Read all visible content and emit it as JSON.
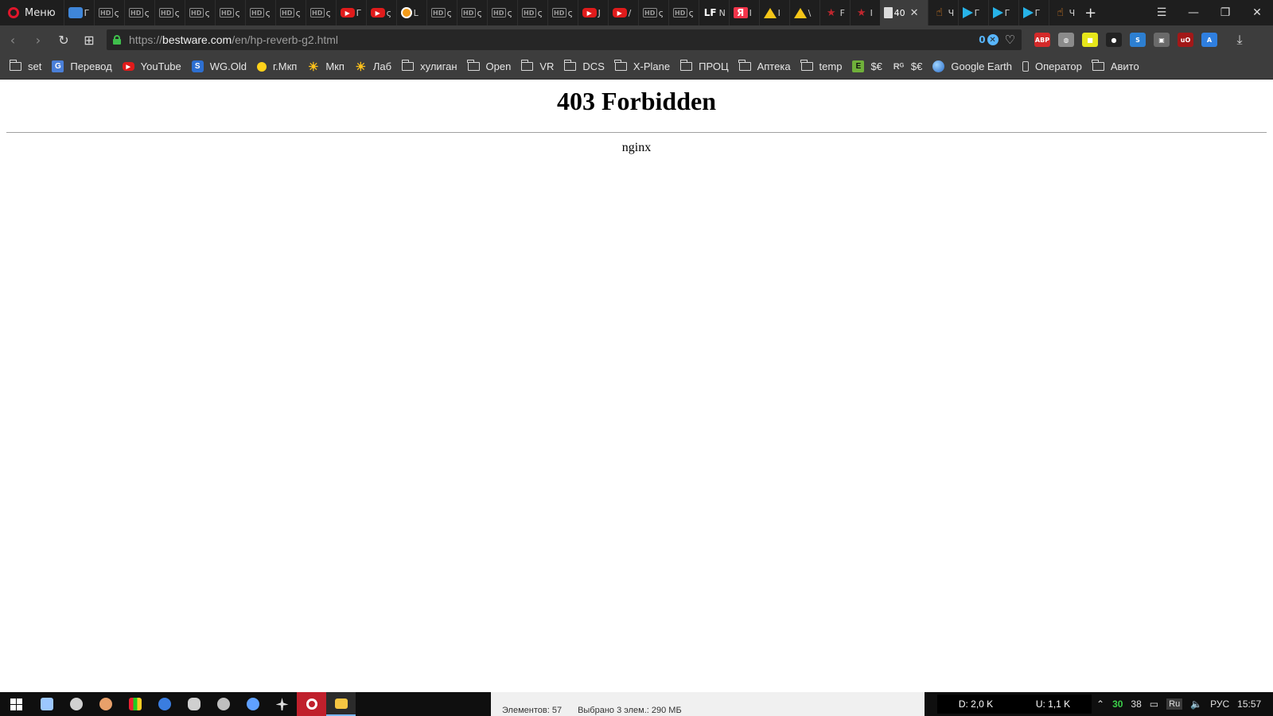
{
  "browser": {
    "menu_label": "Меню",
    "tabs": [
      {
        "fav": "msg",
        "glyph": "",
        "title": "Г"
      },
      {
        "fav": "hd",
        "glyph": "HD",
        "title": "ς"
      },
      {
        "fav": "hd",
        "glyph": "HD",
        "title": "ς"
      },
      {
        "fav": "hd",
        "glyph": "HD",
        "title": "ς"
      },
      {
        "fav": "hd",
        "glyph": "HD",
        "title": "ς"
      },
      {
        "fav": "hd",
        "glyph": "HD",
        "title": "ς"
      },
      {
        "fav": "hd",
        "glyph": "HD",
        "title": "ς"
      },
      {
        "fav": "hd",
        "glyph": "HD",
        "title": "ς"
      },
      {
        "fav": "hd",
        "glyph": "HD",
        "title": "ς"
      },
      {
        "fav": "yt",
        "glyph": "▶",
        "title": "Г"
      },
      {
        "fav": "yt",
        "glyph": "▶",
        "title": "ς"
      },
      {
        "fav": "orange",
        "glyph": "",
        "title": "L"
      },
      {
        "fav": "hd",
        "glyph": "HD",
        "title": "ς"
      },
      {
        "fav": "hd",
        "glyph": "HD",
        "title": "ς"
      },
      {
        "fav": "hd",
        "glyph": "HD",
        "title": "ς"
      },
      {
        "fav": "hd",
        "glyph": "HD",
        "title": "ς"
      },
      {
        "fav": "hd",
        "glyph": "HD",
        "title": "ς"
      },
      {
        "fav": "yt",
        "glyph": "▶",
        "title": "J"
      },
      {
        "fav": "yt",
        "glyph": "▶",
        "title": "/"
      },
      {
        "fav": "hd",
        "glyph": "HD",
        "title": "ς"
      },
      {
        "fav": "hd",
        "glyph": "HD",
        "title": "ς"
      },
      {
        "fav": "lf",
        "glyph": "LF",
        "title": "N"
      },
      {
        "fav": "ya",
        "glyph": "Я",
        "title": "Ⅰ"
      },
      {
        "fav": "drive",
        "glyph": "",
        "title": "I"
      },
      {
        "fav": "drive",
        "glyph": "",
        "title": "\\"
      },
      {
        "fav": "star",
        "glyph": "★",
        "title": "F"
      },
      {
        "fav": "star",
        "glyph": "★",
        "title": "I"
      }
    ],
    "active_tab": {
      "title": "40",
      "close": "✕"
    },
    "tabs_after": [
      {
        "fav": "hand",
        "glyph": "☝",
        "title": "Ч"
      },
      {
        "fav": "play",
        "glyph": "",
        "title": "Г"
      },
      {
        "fav": "play",
        "glyph": "",
        "title": "Г"
      },
      {
        "fav": "play",
        "glyph": "",
        "title": "Г"
      },
      {
        "fav": "hand",
        "glyph": "☝",
        "title": "Ч"
      }
    ],
    "new_tab": "+",
    "window_controls": {
      "tabs_menu": "☰",
      "minimize": "—",
      "restore": "❐",
      "close": "✕"
    },
    "nav": {
      "back": "‹",
      "forward": "›",
      "reload": "↻",
      "speed_dial": "⊞"
    },
    "url": {
      "scheme": "https://",
      "host": "bestware.com",
      "path": "/en/hp-reverb-g2.html"
    },
    "blocked_count": "0",
    "extensions": [
      {
        "name": "adblock-plus-icon",
        "color": "#d42a2a",
        "glyph": "ABP"
      },
      {
        "name": "globe-icon",
        "color": "#8b8b8b",
        "glyph": "◍"
      },
      {
        "name": "color-picker-icon",
        "color": "#e6e61a",
        "glyph": "■"
      },
      {
        "name": "record-icon",
        "color": "#222222",
        "glyph": "●"
      },
      {
        "name": "s-extension-icon",
        "color": "#2d7fd1",
        "glyph": "S"
      },
      {
        "name": "screenshot-icon",
        "color": "#6a6a6a",
        "glyph": "▣"
      },
      {
        "name": "ublock-origin-icon",
        "color": "#a21818",
        "glyph": "uO"
      },
      {
        "name": "translate-icon",
        "color": "#2f7fe0",
        "glyph": "A"
      }
    ],
    "download_icon": "⤓"
  },
  "bookmarks": [
    {
      "icon": "folder",
      "label": "set"
    },
    {
      "icon": "translate",
      "label": "Перевод"
    },
    {
      "icon": "yt",
      "label": "YouTube"
    },
    {
      "icon": "s",
      "label": "WG.Old"
    },
    {
      "icon": "dot",
      "label": "г.Мкп"
    },
    {
      "icon": "sun",
      "label": "Мкп"
    },
    {
      "icon": "sun",
      "label": "Лаб"
    },
    {
      "icon": "folder",
      "label": "хулиган"
    },
    {
      "icon": "folder",
      "label": "Open"
    },
    {
      "icon": "folder",
      "label": "VR"
    },
    {
      "icon": "folder",
      "label": "DCS"
    },
    {
      "icon": "folder",
      "label": "X-Plane"
    },
    {
      "icon": "folder",
      "label": "ПРОЦ"
    },
    {
      "icon": "folder",
      "label": "Аптека"
    },
    {
      "icon": "folder",
      "label": "temp"
    },
    {
      "icon": "e",
      "label": "$€"
    },
    {
      "icon": "rg",
      "label": "$€"
    },
    {
      "icon": "earth",
      "label": "Google Earth"
    },
    {
      "icon": "phone",
      "label": "Оператор"
    },
    {
      "icon": "folder",
      "label": "Авито"
    }
  ],
  "page": {
    "heading": "403 Forbidden",
    "server": "nginx"
  },
  "taskbar": {
    "explorer_items_count": "Элементов: 57",
    "explorer_selected": "Выбрано 3 элем.: 290 МБ",
    "download_rate": "D: 2,0 K",
    "upload_rate": "U: 1,1 K",
    "tray_green": "30",
    "tray_num": "38",
    "lang_short": "Ru",
    "lang": "РУС",
    "clock": "15:57"
  }
}
